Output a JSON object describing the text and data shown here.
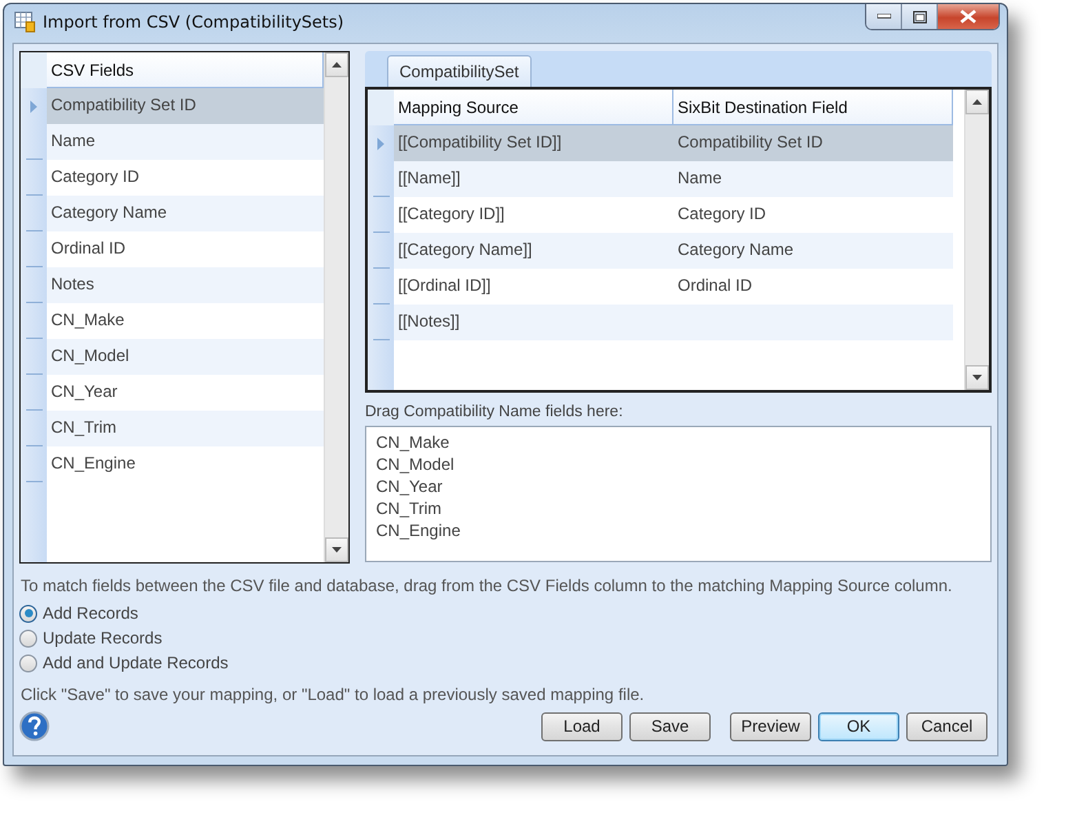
{
  "window": {
    "title": "Import from CSV (CompatibilitySets)"
  },
  "csv_fields": {
    "header": "CSV Fields",
    "rows": [
      {
        "name": "Compatibility Set ID",
        "selected": true
      },
      {
        "name": "Name",
        "selected": false
      },
      {
        "name": "Category ID",
        "selected": false
      },
      {
        "name": "Category Name",
        "selected": false
      },
      {
        "name": "Ordinal ID",
        "selected": false
      },
      {
        "name": "Notes",
        "selected": false
      },
      {
        "name": "CN_Make",
        "selected": false
      },
      {
        "name": "CN_Model",
        "selected": false
      },
      {
        "name": "CN_Year",
        "selected": false
      },
      {
        "name": "CN_Trim",
        "selected": false
      },
      {
        "name": "CN_Engine",
        "selected": false
      }
    ]
  },
  "tabs": [
    {
      "label": "CompatibilitySet",
      "selected": true
    }
  ],
  "mapping": {
    "columns": [
      "Mapping Source",
      "SixBit Destination Field"
    ],
    "rows": [
      {
        "source": "[[Compatibility Set ID]]",
        "destination": "Compatibility Set ID",
        "selected": true
      },
      {
        "source": "[[Name]]",
        "destination": "Name",
        "selected": false
      },
      {
        "source": "[[Category ID]]",
        "destination": "Category ID",
        "selected": false
      },
      {
        "source": "[[Category Name]]",
        "destination": "Category Name",
        "selected": false
      },
      {
        "source": "[[Ordinal ID]]",
        "destination": "Ordinal ID",
        "selected": false
      },
      {
        "source": "[[Notes]]",
        "selected": false
      }
    ]
  },
  "compat_names": {
    "label": "Drag Compatibility Name fields here:",
    "lines": [
      "CN_Make",
      "CN_Model",
      "CN_Year",
      "CN_Trim",
      "CN_Engine"
    ]
  },
  "instructions": "To match fields between the CSV file and database, drag from the CSV Fields column to the matching Mapping Source column.",
  "modes": [
    {
      "label": "Add Records",
      "selected": true
    },
    {
      "label": "Update Records",
      "selected": false
    },
    {
      "label": "Add and Update Records",
      "selected": false
    }
  ],
  "save_hint": "Click \"Save\" to save your mapping, or \"Load\" to load a previously saved mapping file.",
  "buttons": [
    {
      "label": "Load",
      "focused": false
    },
    {
      "label": "Save",
      "focused": false
    },
    {
      "label": "Preview",
      "focused": false
    },
    {
      "label": "OK",
      "focused": true
    },
    {
      "label": "Cancel",
      "focused": false
    }
  ]
}
